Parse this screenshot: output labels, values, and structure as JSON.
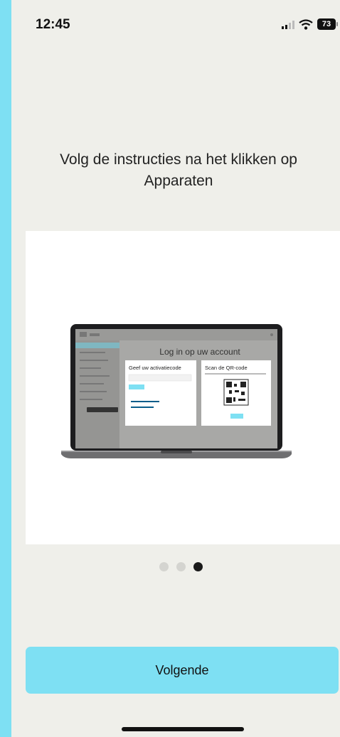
{
  "status_bar": {
    "time": "12:45",
    "battery": "73"
  },
  "instruction": "Volg de instructies na het klikken op Apparaten",
  "illustration": {
    "login_title": "Log in op uw account",
    "activation_title": "Geef uw activatiecode",
    "qr_title": "Scan de QR-code"
  },
  "pagination": {
    "count": 3,
    "active": 3
  },
  "next_button": "Volgende"
}
